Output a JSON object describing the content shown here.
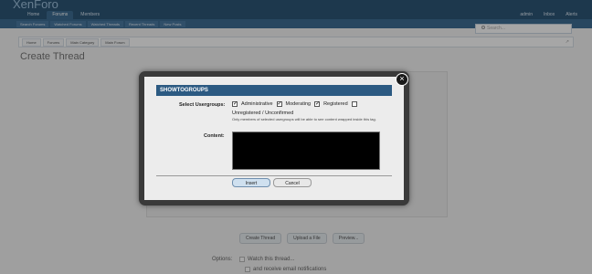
{
  "header": {
    "logo": "XenForo",
    "tabs": [
      "Home",
      "Forums",
      "Members"
    ],
    "active_tab": 1,
    "links": [
      "admin",
      "Inbox",
      "Alerts"
    ]
  },
  "subnav": {
    "items": [
      "Search Forums",
      "Watched Forums",
      "Watched Threads",
      "Recent Threads",
      "New Posts"
    ]
  },
  "search": {
    "placeholder": "Search..."
  },
  "breadcrumb": [
    "Home",
    "Forums",
    "Main Category",
    "Main Forum"
  ],
  "page": {
    "title": "Create Thread"
  },
  "modal": {
    "title": "SHOWTOGROUPS",
    "usergroups_label": "Select Usergroups:",
    "usergroups": [
      {
        "name": "Administrative",
        "checked": true
      },
      {
        "name": "Moderating",
        "checked": true
      },
      {
        "name": "Registered",
        "checked": true
      },
      {
        "name": "Unregistered / Unconfirmed",
        "checked": false
      }
    ],
    "hint": "Only members of selected usergroups will be able to see content wrapped inside this tag.",
    "content_label": "Content:",
    "insert_label": "Insert",
    "cancel_label": "Cancel"
  },
  "bottom": {
    "buttons": [
      "Create Thread",
      "Upload a File",
      "Preview..."
    ],
    "options_label": "Options:",
    "watch_label": "Watch this thread...",
    "email_label": "and receive email notifications"
  }
}
